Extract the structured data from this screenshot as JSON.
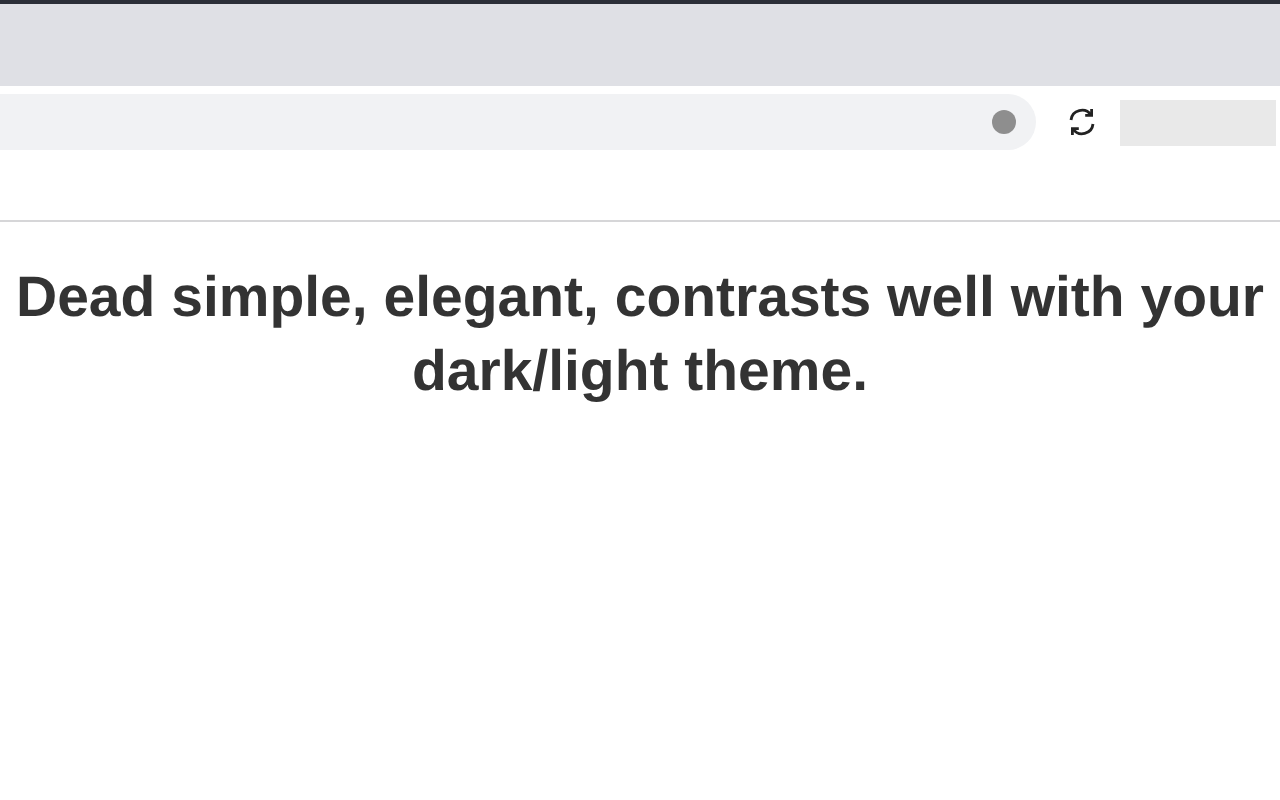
{
  "heading": "Dead simple, elegant, contrasts well with your dark/light theme."
}
